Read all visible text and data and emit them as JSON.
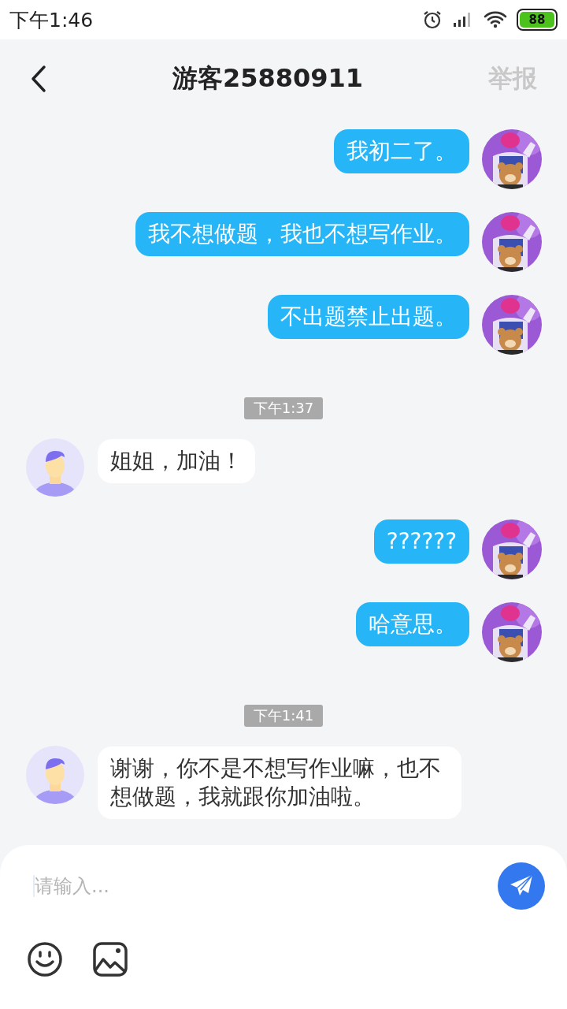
{
  "status_bar": {
    "time": "下午1:46",
    "battery": "88"
  },
  "header": {
    "title": "游客25880911",
    "action": "举报"
  },
  "messages": [
    {
      "kind": "sent",
      "text": "我初二了。"
    },
    {
      "kind": "sent",
      "text": "我不想做题，我也不想写作业。"
    },
    {
      "kind": "sent",
      "text": "不出题禁止出题。"
    },
    {
      "kind": "time",
      "text": "下午1:37"
    },
    {
      "kind": "received",
      "text": "姐姐，加油！"
    },
    {
      "kind": "sent",
      "text": "??????"
    },
    {
      "kind": "sent",
      "text": "哈意思。"
    },
    {
      "kind": "time",
      "text": "下午1:41"
    },
    {
      "kind": "received",
      "text": "谢谢，你不是不想写作业嘛，也不想做题，我就跟你加油啦。"
    }
  ],
  "composer": {
    "placeholder": "请输入..."
  }
}
